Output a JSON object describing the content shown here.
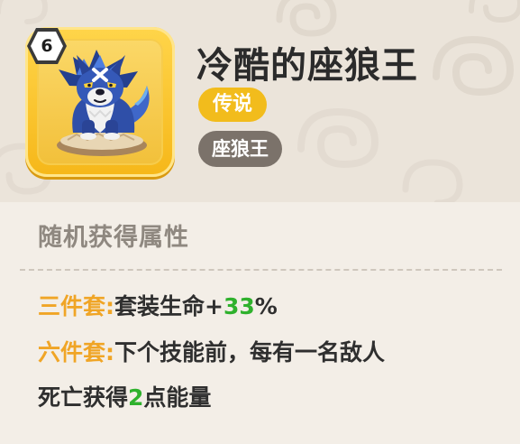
{
  "item": {
    "level": "6",
    "name": "冷酷的座狼王",
    "rarity": "传说",
    "type": "座狼王"
  },
  "attributes": {
    "section_title": "随机获得属性",
    "three_set": {
      "label": "三件套:",
      "text_before": "套装生命+",
      "value": "33",
      "suffix": "%"
    },
    "six_set": {
      "label": "六件套:",
      "line1": "下个技能前，每有一名敌人",
      "line2_before": "死亡获得",
      "value": "2",
      "line2_after": "点能量"
    }
  },
  "colors": {
    "header_bg": "#ebe4da",
    "body_bg": "#f3eee7",
    "frame_gold": "#f6b719",
    "rarity_badge": "#f2bc1c",
    "type_badge": "#7b726a",
    "set_label": "#f0a526",
    "highlight_value": "#2fb12d",
    "section_title": "#8f8880"
  },
  "icons": {
    "level_badge": "hexagon-badge-icon",
    "portrait": "blue-wolf-mount-icon",
    "background_pattern": "swirl-pattern-icon"
  }
}
